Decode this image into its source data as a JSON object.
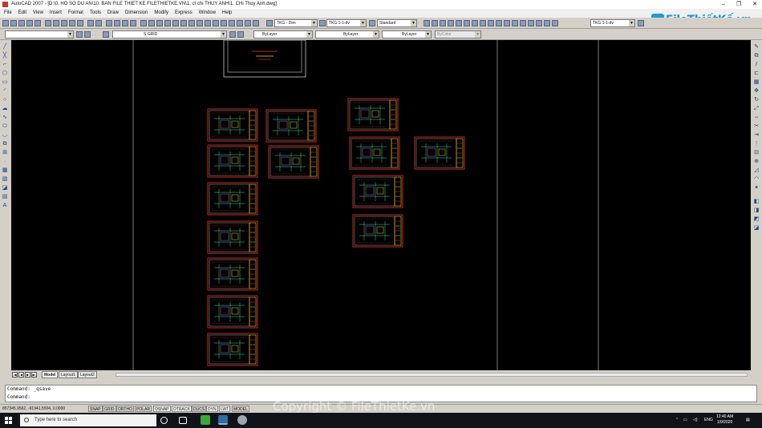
{
  "window": {
    "title": "AutoCAD 2007 - [D:\\0. HO SO DU AN\\10. BAN FILE THIET KE FILETHIETKE.VN\\1. ct chi THUY ANH\\1. CHi Thuy Anh.dwg]",
    "controls": [
      "–",
      "❐",
      "✕"
    ]
  },
  "menu": [
    "File",
    "Edit",
    "View",
    "Insert",
    "Format",
    "Tools",
    "Draw",
    "Dimension",
    "Modify",
    "Express",
    "Window",
    "Help"
  ],
  "toolbar1": {
    "dim_style": "TKG - Dim",
    "text_style": "TKG 1-1-dv",
    "table_style": "Standard",
    "scale_style": "TKG 1-1-dv"
  },
  "toolbar2": {
    "workspace": "",
    "layer": "S GRID",
    "color": "ByLayer",
    "linetype": "ByLayer",
    "lineweight": "ByLayer",
    "plotstyle": "ByColor"
  },
  "logo": {
    "text": "FileThiếtKế.vn",
    "color": "#1e9ad6"
  },
  "layout_tabs": [
    "Model",
    "Layout1",
    "Layout2"
  ],
  "active_tab": "Model",
  "command": {
    "history": "Command: _qsave",
    "prompt": "Command:"
  },
  "status": {
    "coords": "857345.9562, -91941.5504, 0.0000",
    "toggles": [
      "SNAP",
      "GRID",
      "ORTHO",
      "POLAR",
      "OSNAP",
      "OTRACK",
      "DUCS",
      "DYN",
      "LWT",
      "MODEL"
    ],
    "active_toggles": [
      "OSNAP",
      "OTRACK",
      "DYN",
      "LWT"
    ]
  },
  "watermark": "Copyright © FileThietKe.vn",
  "taskbar": {
    "search_placeholder": "Type here to search",
    "language": "ENG",
    "time": "12:40 AM",
    "date": "1/9/2020"
  },
  "colors": {
    "canvas": "#000000",
    "title_block": "#ff3030",
    "cad_yellow": "#ffd21f",
    "cad_cyan": "#2fd6e8",
    "cad_green": "#36d84a"
  }
}
